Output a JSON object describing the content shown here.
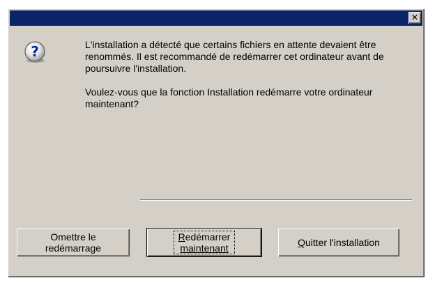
{
  "window": {
    "title": ""
  },
  "titlebar": {
    "close_glyph": "✕"
  },
  "icon": {
    "name": "question-icon",
    "glyph": "?"
  },
  "message": {
    "paragraph1": "L'installation a détecté que certains fichiers en attente devaient être renommés. Il est recommandé de redémarrer cet ordinateur avant de poursuivre l'installation.",
    "paragraph2": "Voulez-vous que la fonction Installation redémarre votre ordinateur maintenant?"
  },
  "buttons": {
    "skip_line1": "Omettre le",
    "skip_line2": "redémarrage",
    "restart_mnemonic": "R",
    "restart_rest": "edémarrer",
    "restart_line2": "maintenant",
    "quit_mnemonic": "Q",
    "quit_rest": "uitter l'installation"
  },
  "colors": {
    "titlebar": "#0a246a",
    "face": "#d4d0c8"
  }
}
